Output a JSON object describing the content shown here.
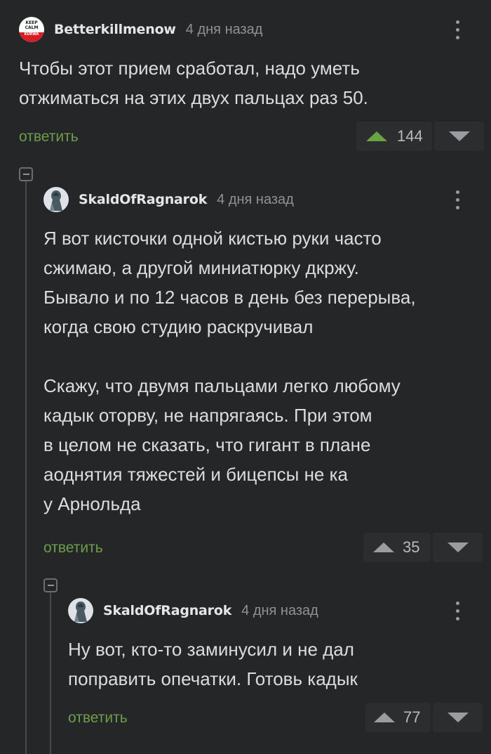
{
  "reply_label": "ответить",
  "colors": {
    "accent_green": "#6aa342",
    "reply_green": "#6d9d4c",
    "background": "#242628"
  },
  "icons": [
    "keep-calm-avatar",
    "knight-avatar",
    "more-vertical-icon",
    "upvote-icon",
    "downvote-icon",
    "collapse-icon"
  ],
  "comments": [
    {
      "username": "Betterkillmenow",
      "time": "4 дня назад",
      "avatar_text": [
        "KEEP",
        "CALM",
        "KURWA"
      ],
      "text": "Чтобы этот прием сработал, надо уметь\nотжиматься на этих двух пальцах раз 50.",
      "rating": "144",
      "upvoted": true
    },
    {
      "username": "SkaldOfRagnarok",
      "time": "4 дня назад",
      "text": "Я вот кисточки одной кистью руки часто\nсжимаю, а другой миниатюрку дкржу.\nБывало и по 12 часов в день без перерыва,\nкогда свою студию раскручивал\n\nСкажу, что двумя пальцами легко любому\nкадык оторву, не напрягаясь. При этом\nв целом не сказать, что гигант в плане\nаоднятия тяжестей и бицепсы не ка\nу Арнольда",
      "rating": "35",
      "upvoted": false
    },
    {
      "username": "SkaldOfRagnarok",
      "time": "4 дня назад",
      "text": "Ну вот, кто-то заминусил и не дал\nпоправить опечатки. Готовь кадык",
      "rating": "77",
      "upvoted": false
    }
  ]
}
